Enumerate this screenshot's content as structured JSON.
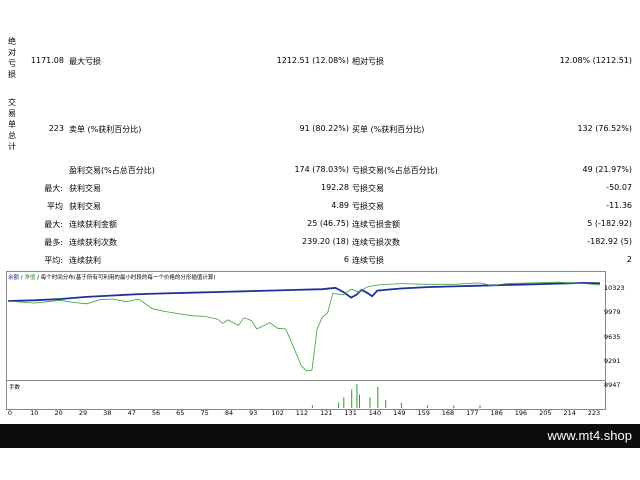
{
  "side_labels": {
    "absolute": "绝对亏损",
    "total_trades": "交易单总计"
  },
  "row1": {
    "absolute_loss": "1171.08",
    "max_loss_label": "最大亏损",
    "max_loss_value": "1212.51 (12.08%)",
    "relative_label": "相对亏损",
    "relative_value": "12.08% (1212.51)"
  },
  "row2": {
    "total_trades": "223",
    "sell_label": "卖单 (%获利百分比)",
    "sell_value": "91 (80.22%)",
    "buy_label": "买单 (%获利百分比)",
    "buy_value": "132 (76.52%)"
  },
  "stats": [
    {
      "prefix": "",
      "label1": "盈利交易(%占总百分比)",
      "value1": "174 (78.03%)",
      "label2": "亏损交易(%占总百分比)",
      "value2": "49 (21.97%)"
    },
    {
      "prefix": "最大:",
      "label1": "获利交易",
      "value1": "192.28",
      "label2": "亏损交易",
      "value2": "-50.07"
    },
    {
      "prefix": "平均",
      "label1": "获利交易",
      "value1": "4.89",
      "label2": "亏损交易",
      "value2": "-11.36"
    },
    {
      "prefix": "最大:",
      "label1": "连续获利金额",
      "value1": "25 (46.75)",
      "label2": "连续亏损金额",
      "value2": "5 (-182.92)"
    },
    {
      "prefix": "最多:",
      "label1": "连续获利次数",
      "value1": "239.20 (18)",
      "label2": "连续亏损次数",
      "value2": "-182.92 (5)"
    },
    {
      "prefix": "平均:",
      "label1": "连续获利",
      "value1": "6",
      "label2": "连续亏损",
      "value2": "2"
    }
  ],
  "chart_legend": {
    "balance": "余额",
    "sep": "/",
    "equity": "净值",
    "note": "/ 每个时间分布(基于所有可利用的最小时段的每一个价格的分形插值计算)"
  },
  "sub_label": "手数",
  "colors": {
    "balance": "#1f2f9f",
    "equity": "#3a9f3a",
    "volume": "#2a9f2a",
    "footer_bg": "#0d0d0d"
  },
  "footer": "www.mt4.shop",
  "chart_data": {
    "type": "line",
    "y_ticks": [
      "10323",
      "9979",
      "9635",
      "9291",
      "8947"
    ],
    "x_ticks": [
      "0",
      "10",
      "20",
      "29",
      "38",
      "47",
      "56",
      "65",
      "75",
      "84",
      "93",
      "102",
      "112",
      "121",
      "131",
      "140",
      "149",
      "159",
      "168",
      "177",
      "186",
      "196",
      "205",
      "214",
      "223"
    ],
    "ylim": [
      8947,
      10323
    ],
    "xlim": [
      0,
      226
    ],
    "series": [
      {
        "role": "balance",
        "points": [
          [
            0,
            10050
          ],
          [
            10,
            10060
          ],
          [
            20,
            10080
          ],
          [
            30,
            10110
          ],
          [
            40,
            10130
          ],
          [
            50,
            10150
          ],
          [
            60,
            10160
          ],
          [
            70,
            10170
          ],
          [
            80,
            10180
          ],
          [
            90,
            10190
          ],
          [
            100,
            10200
          ],
          [
            110,
            10210
          ],
          [
            120,
            10220
          ],
          [
            125,
            10240
          ],
          [
            128,
            10180
          ],
          [
            131,
            10100
          ],
          [
            133,
            10140
          ],
          [
            135,
            10210
          ],
          [
            137,
            10170
          ],
          [
            139,
            10120
          ],
          [
            141,
            10200
          ],
          [
            150,
            10230
          ],
          [
            160,
            10250
          ],
          [
            170,
            10260
          ],
          [
            180,
            10270
          ],
          [
            190,
            10280
          ],
          [
            200,
            10290
          ],
          [
            210,
            10300
          ],
          [
            220,
            10310
          ],
          [
            226,
            10305
          ]
        ]
      },
      {
        "role": "equity",
        "points": [
          [
            0,
            10050
          ],
          [
            10,
            10020
          ],
          [
            15,
            10040
          ],
          [
            20,
            10060
          ],
          [
            25,
            10030
          ],
          [
            30,
            10010
          ],
          [
            35,
            10070
          ],
          [
            40,
            10080
          ],
          [
            45,
            10040
          ],
          [
            50,
            10080
          ],
          [
            55,
            9940
          ],
          [
            60,
            9900
          ],
          [
            65,
            9870
          ],
          [
            70,
            9840
          ],
          [
            75,
            9830
          ],
          [
            80,
            9790
          ],
          [
            82,
            9730
          ],
          [
            84,
            9780
          ],
          [
            88,
            9700
          ],
          [
            90,
            9810
          ],
          [
            93,
            9770
          ],
          [
            95,
            9650
          ],
          [
            100,
            9740
          ],
          [
            103,
            9660
          ],
          [
            106,
            9650
          ],
          [
            108,
            9480
          ],
          [
            110,
            9300
          ],
          [
            112,
            9120
          ],
          [
            114,
            9050
          ],
          [
            116,
            9060
          ],
          [
            118,
            9650
          ],
          [
            120,
            9820
          ],
          [
            122,
            9880
          ],
          [
            124,
            10160
          ],
          [
            128,
            10140
          ],
          [
            131,
            10220
          ],
          [
            134,
            10180
          ],
          [
            137,
            10250
          ],
          [
            141,
            10280
          ],
          [
            150,
            10300
          ],
          [
            160,
            10290
          ],
          [
            170,
            10290
          ],
          [
            180,
            10310
          ],
          [
            185,
            10270
          ],
          [
            190,
            10300
          ],
          [
            200,
            10310
          ],
          [
            210,
            10320
          ],
          [
            220,
            10300
          ],
          [
            226,
            10280
          ]
        ]
      }
    ],
    "volume": [
      [
        116,
        1
      ],
      [
        126,
        2
      ],
      [
        128,
        4
      ],
      [
        131,
        7
      ],
      [
        133,
        9
      ],
      [
        134,
        5
      ],
      [
        138,
        4
      ],
      [
        141,
        8
      ],
      [
        144,
        3
      ],
      [
        150,
        2
      ],
      [
        160,
        1
      ],
      [
        170,
        1
      ],
      [
        180,
        1
      ]
    ]
  }
}
